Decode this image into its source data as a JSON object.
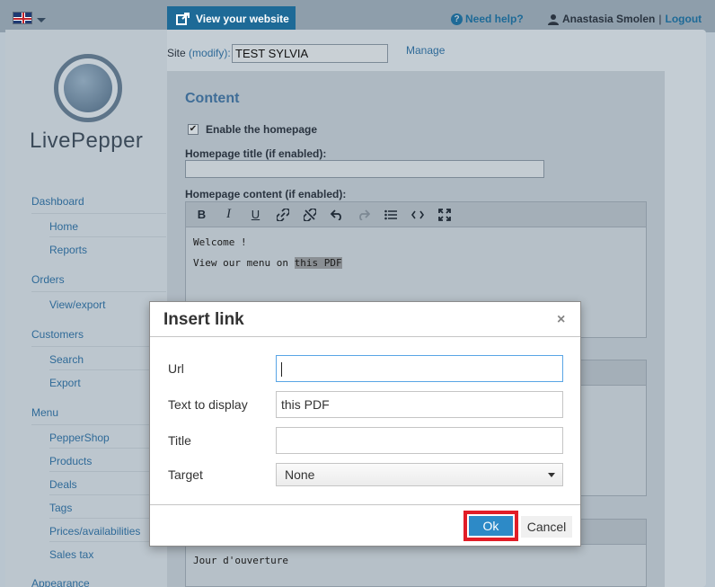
{
  "header": {
    "view_site_label": "View your website",
    "help_label": "Need help?",
    "user_name": "Anastasia Smolen",
    "separator": "|",
    "logout_label": "Logout"
  },
  "site": {
    "label": "Site",
    "modify_label": "(modify):",
    "value": "TEST SYLVIA",
    "manage_label": "Manage"
  },
  "logo": {
    "text": "LivePepper"
  },
  "sidebar": {
    "sections": [
      {
        "label": "Dashboard",
        "items": [
          "Home",
          "Reports"
        ]
      },
      {
        "label": "Orders",
        "items": [
          "View/export"
        ]
      },
      {
        "label": "Customers",
        "items": [
          "Search",
          "Export"
        ]
      },
      {
        "label": "Menu",
        "items": [
          "PepperShop",
          "Products",
          "Deals",
          "Tags",
          "Prices/availabilities",
          "Sales tax"
        ]
      },
      {
        "label": "Appearance",
        "items": []
      }
    ]
  },
  "content": {
    "title": "Content",
    "enable_homepage_label": "Enable the homepage",
    "enable_homepage_checked": true,
    "homepage_title_label": "Homepage title (if enabled):",
    "homepage_content_label": "Homepage content (if enabled):",
    "editor_lines": [
      "Welcome !",
      "View our menu on "
    ],
    "editor_selected_text": "this PDF",
    "box3_text": "Jour d'ouverture"
  },
  "dialog": {
    "title": "Insert link",
    "close_symbol": "×",
    "fields": {
      "url_label": "Url",
      "url_value": "",
      "text_label": "Text to display",
      "text_value": "this PDF",
      "title_label": "Title",
      "title_value": "",
      "target_label": "Target",
      "target_value": "None"
    },
    "ok_label": "Ok",
    "cancel_label": "Cancel"
  },
  "colors": {
    "accent": "#1e6a97",
    "ok_button": "#2d8ac7",
    "highlight_frame": "#e11d27"
  }
}
